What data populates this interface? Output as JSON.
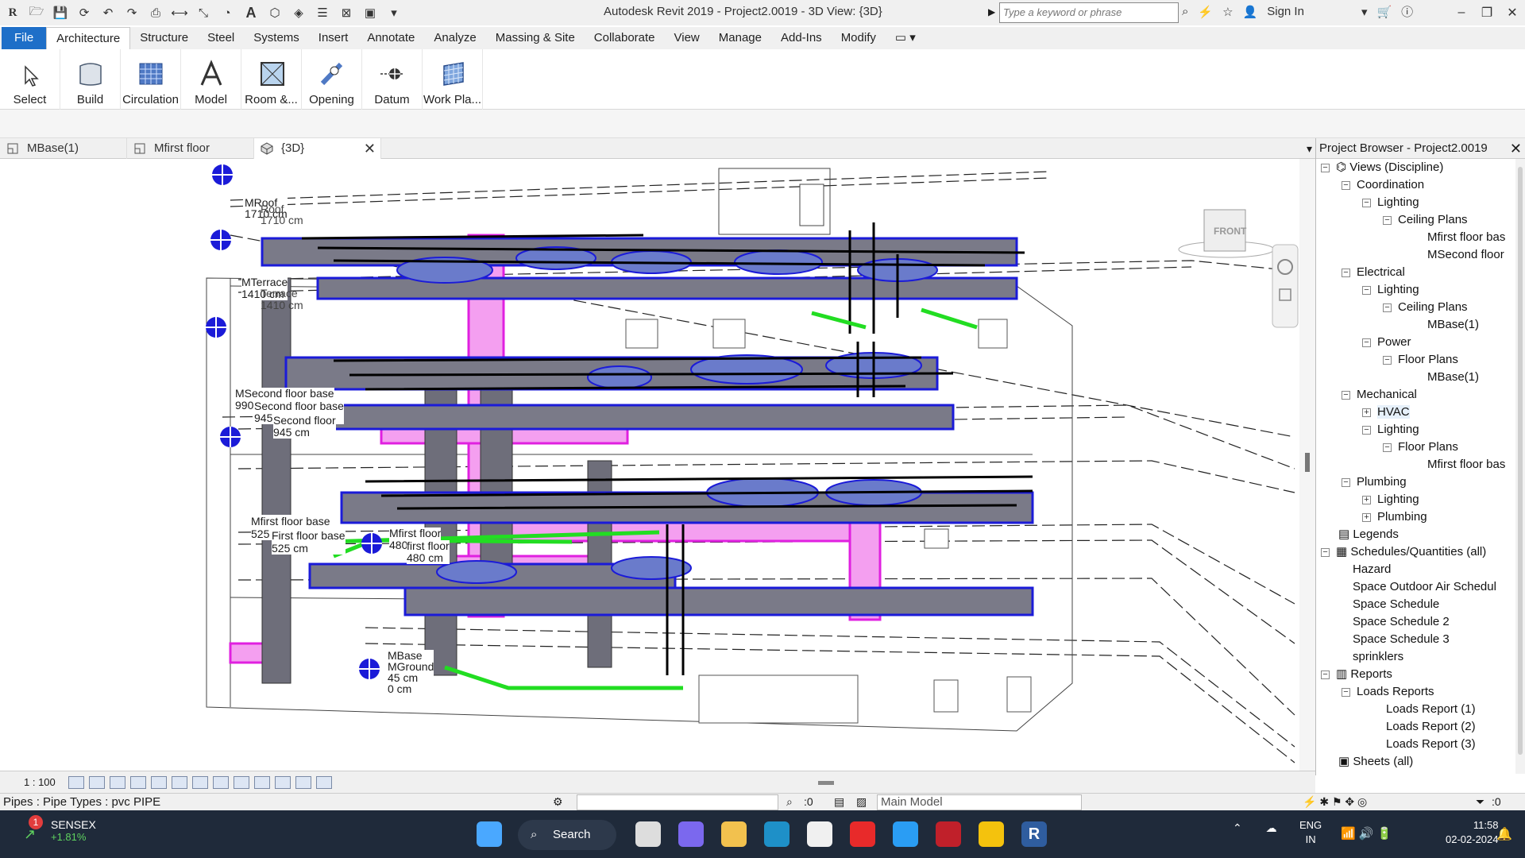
{
  "titlebar": {
    "app_title": "Autodesk Revit 2019 - Project2.0019 - 3D View: {3D}",
    "search_placeholder": "Type a keyword or phrase",
    "sign_in": "Sign In"
  },
  "ribbon_tabs": [
    "File",
    "Architecture",
    "Structure",
    "Steel",
    "Systems",
    "Insert",
    "Annotate",
    "Analyze",
    "Massing & Site",
    "Collaborate",
    "View",
    "Manage",
    "Add-Ins",
    "Modify"
  ],
  "active_tab": "Architecture",
  "ribbon_buttons": [
    "Select",
    "Build",
    "Circulation",
    "Model",
    "Room &...",
    "Opening",
    "Datum",
    "Work Pla..."
  ],
  "view_tabs": [
    {
      "label": "MBase(1)"
    },
    {
      "label": "Mfirst floor"
    },
    {
      "label": "{3D}"
    }
  ],
  "levels": [
    {
      "name": "MRoof",
      "elev": "1710 cm",
      "ghost": "Roof"
    },
    {
      "name": "MTerrace",
      "elev": "1410 cm",
      "ghost": "Terrace"
    },
    {
      "name": "MSecond floor base",
      "elev": "990 cm",
      "ghost": "Second floor base"
    },
    {
      "name": "Second floor",
      "elev": "945 cm"
    },
    {
      "name": "Mfirst floor base",
      "elev": "525 cm",
      "ghost": "First floor base"
    },
    {
      "name": "Mfirst floor",
      "elev": "480 cm",
      "ghost": "first floor"
    },
    {
      "name": "MBase",
      "elev": "45 cm",
      "ghost": "MGround"
    },
    {
      "name": "",
      "elev": "0 cm"
    }
  ],
  "viewcube": {
    "face": "FRONT"
  },
  "project_browser": {
    "title": "Project Browser - Project2.0019",
    "nodes": [
      {
        "label": "Views (Discipline)",
        "toggle": "−"
      },
      {
        "label": "Coordination",
        "toggle": "−"
      },
      {
        "label": "Lighting",
        "toggle": "−"
      },
      {
        "label": "Ceiling Plans",
        "toggle": "−"
      },
      {
        "label": "Mfirst floor bas",
        "toggle": ""
      },
      {
        "label": "MSecond floor",
        "toggle": ""
      },
      {
        "label": "Electrical",
        "toggle": "−"
      },
      {
        "label": "Lighting",
        "toggle": "−"
      },
      {
        "label": "Ceiling Plans",
        "toggle": "−"
      },
      {
        "label": "MBase(1)",
        "toggle": ""
      },
      {
        "label": "Power",
        "toggle": "−"
      },
      {
        "label": "Floor Plans",
        "toggle": "−"
      },
      {
        "label": "MBase(1)",
        "toggle": ""
      },
      {
        "label": "Mechanical",
        "toggle": "−"
      },
      {
        "label": "HVAC",
        "toggle": "+"
      },
      {
        "label": "Lighting",
        "toggle": "−"
      },
      {
        "label": "Floor Plans",
        "toggle": "−"
      },
      {
        "label": "Mfirst floor bas",
        "toggle": ""
      },
      {
        "label": "Plumbing",
        "toggle": "−"
      },
      {
        "label": "Lighting",
        "toggle": "+"
      },
      {
        "label": "Plumbing",
        "toggle": "+"
      },
      {
        "label": "Legends",
        "toggle": ""
      },
      {
        "label": "Schedules/Quantities (all)",
        "toggle": "−"
      },
      {
        "label": "Hazard",
        "toggle": ""
      },
      {
        "label": "Space Outdoor Air Schedul",
        "toggle": ""
      },
      {
        "label": "Space Schedule",
        "toggle": ""
      },
      {
        "label": "Space Schedule 2",
        "toggle": ""
      },
      {
        "label": "Space Schedule 3",
        "toggle": ""
      },
      {
        "label": "sprinklers",
        "toggle": ""
      },
      {
        "label": "Reports",
        "toggle": "−"
      },
      {
        "label": "Loads Reports",
        "toggle": "−"
      },
      {
        "label": "Loads Report (1)",
        "toggle": ""
      },
      {
        "label": "Loads Report (2)",
        "toggle": ""
      },
      {
        "label": "Loads Report (3)",
        "toggle": ""
      },
      {
        "label": "Sheets (all)",
        "toggle": ""
      }
    ]
  },
  "viewbar": {
    "scale": "1 : 100"
  },
  "statusbar": {
    "text": "Pipes : Pipe Types : pvc PIPE",
    "select_count": ":0",
    "model": "Main Model",
    "filter_count": ":0"
  },
  "taskbar": {
    "ticker_name": "SENSEX",
    "ticker_change": "+1.81%",
    "ticker_badge": "1",
    "search_label": "Search",
    "lang_1": "ENG",
    "lang_2": "IN",
    "time": "11:58",
    "date": "02-02-2024"
  },
  "colors": {
    "duct": "#1b1bd8",
    "duct_fill": "#6e6e7a",
    "pipe_pink": "#e020e0",
    "pipe_green": "#22dd22",
    "accent": "#1e6fc8"
  }
}
